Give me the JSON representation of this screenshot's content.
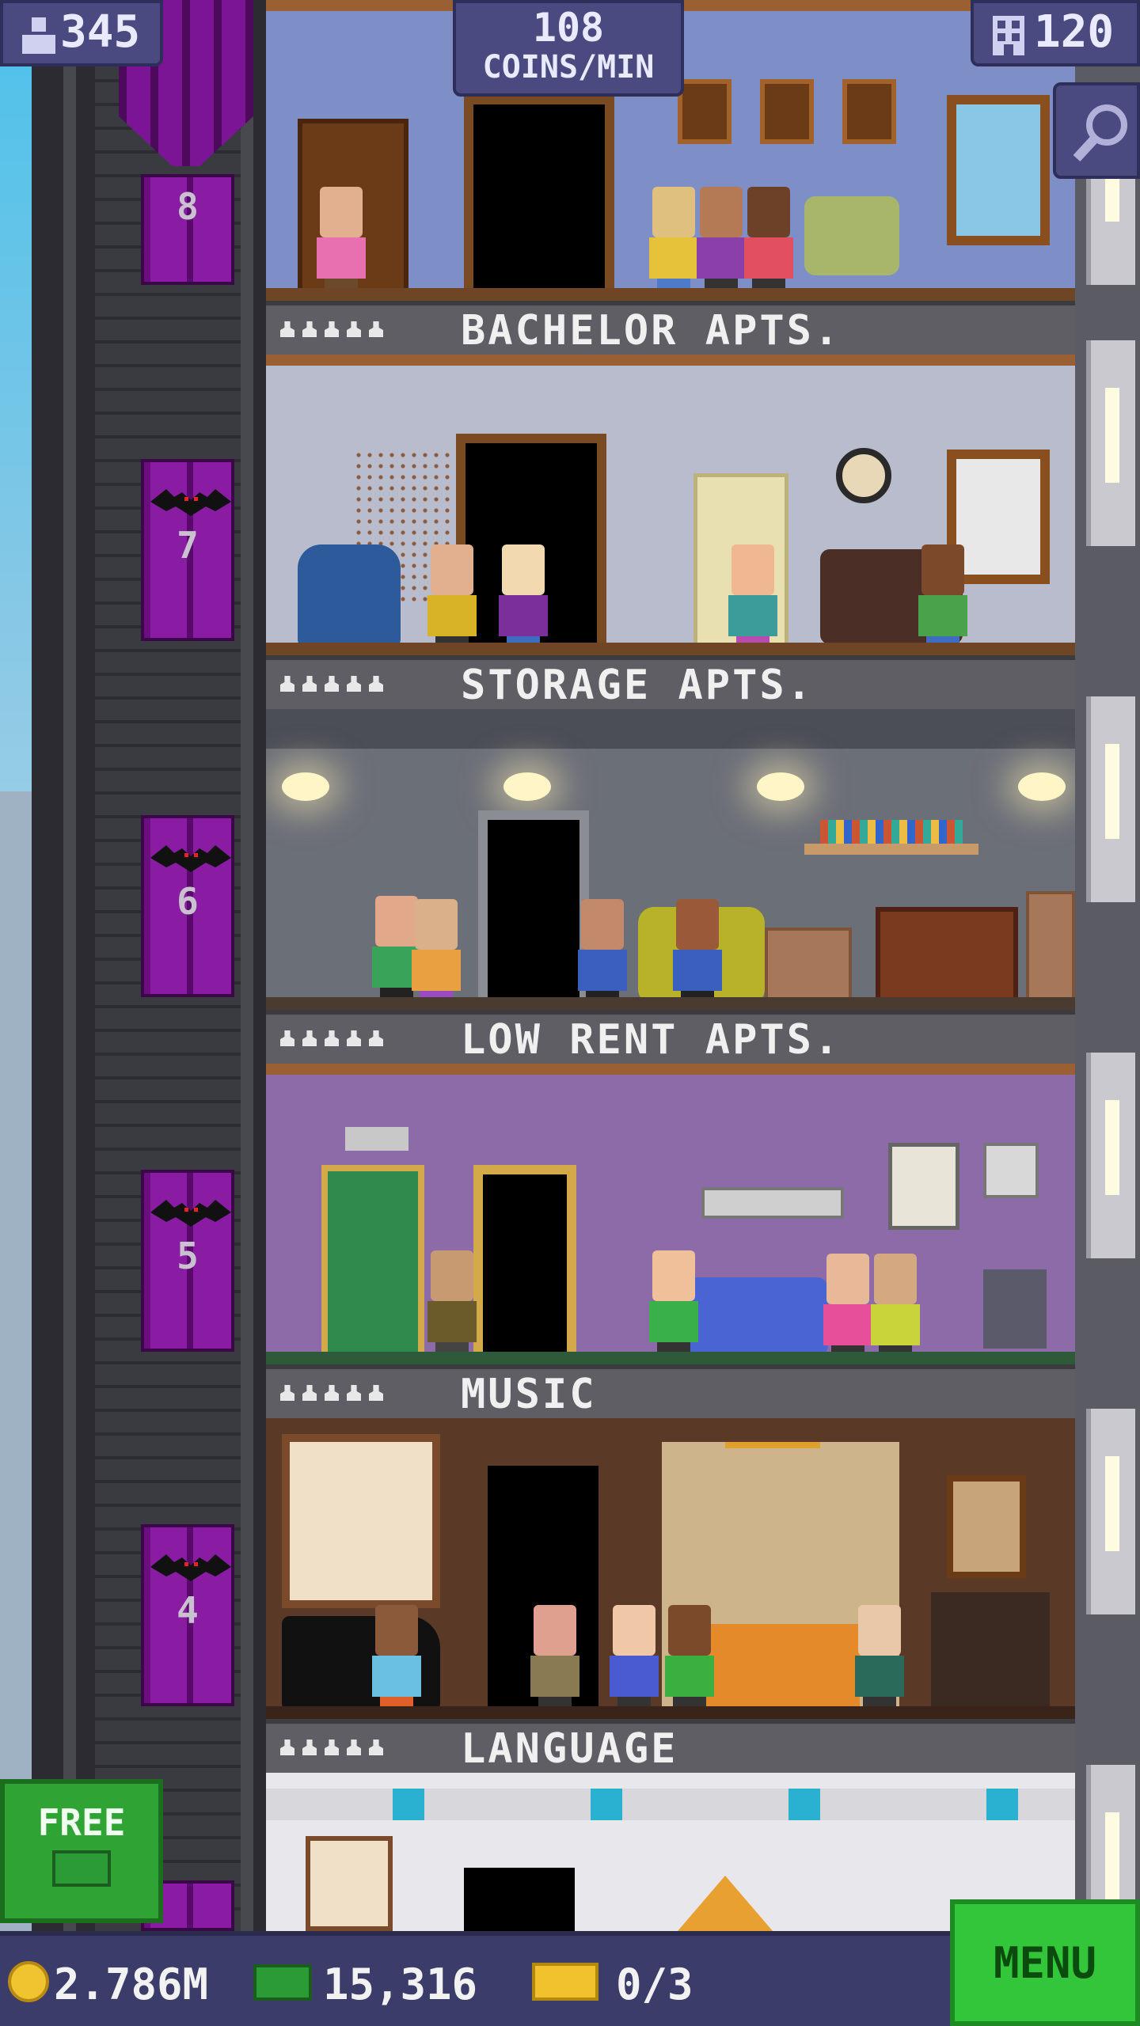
{
  "hud": {
    "population": "345",
    "rate_value": "108",
    "rate_unit": "COINS/MIN",
    "floors": "120"
  },
  "floors": [
    {
      "name": "BACHELOR APTS.",
      "elevator_floor": "8"
    },
    {
      "name": "STORAGE APTS.",
      "elevator_floor": "7"
    },
    {
      "name": "LOW RENT APTS.",
      "elevator_floor": "6"
    },
    {
      "name": "MUSIC",
      "elevator_floor": "5"
    },
    {
      "name": "LANGUAGE",
      "elevator_floor": "4"
    }
  ],
  "buttons": {
    "free": "FREE",
    "menu": "MENU"
  },
  "bottom_bar": {
    "coins": "2.786M",
    "bux": "15,316",
    "tickets": "0/3"
  },
  "icons": {
    "population": "person-icon",
    "floors": "building-icon",
    "search": "magnifier-icon",
    "coins": "coin-icon",
    "bux": "tower-bux-icon",
    "tickets": "golden-ticket-icon"
  },
  "colors": {
    "elevator": "#8a1ca3",
    "hud_bg": "#4a4a80",
    "menu_green": "#33c53a"
  }
}
